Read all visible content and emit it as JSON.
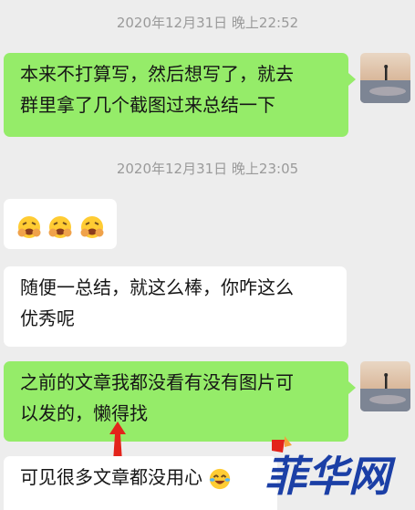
{
  "messages": [
    {
      "type": "timestamp",
      "text": "2020年12月31日 晚上22:52"
    },
    {
      "type": "outgoing",
      "line1": "本来不打算写，然后想写了，就去",
      "line2": "群里拿了几个截图过来总结一下"
    },
    {
      "type": "timestamp",
      "text": "2020年12月31日 晚上23:05"
    },
    {
      "type": "incoming",
      "content": "emoji",
      "emojis": [
        "tired-face-emoji",
        "tired-face-emoji",
        "tired-face-emoji"
      ]
    },
    {
      "type": "incoming",
      "line1": "随便一总结，就这么棒，你咋这么",
      "line2": "优秀呢"
    },
    {
      "type": "outgoing",
      "line1": "之前的文章我都没看有没有图片可",
      "line2": "以发的，懒得找"
    },
    {
      "type": "incoming",
      "text": "可见很多文章都没用心"
    }
  ],
  "watermark": {
    "text": "菲华网"
  },
  "colors": {
    "outgoing_bubble": "#95ec69",
    "incoming_bubble": "#ffffff",
    "background": "#ededed",
    "annotation_arrow": "#e3241b"
  }
}
